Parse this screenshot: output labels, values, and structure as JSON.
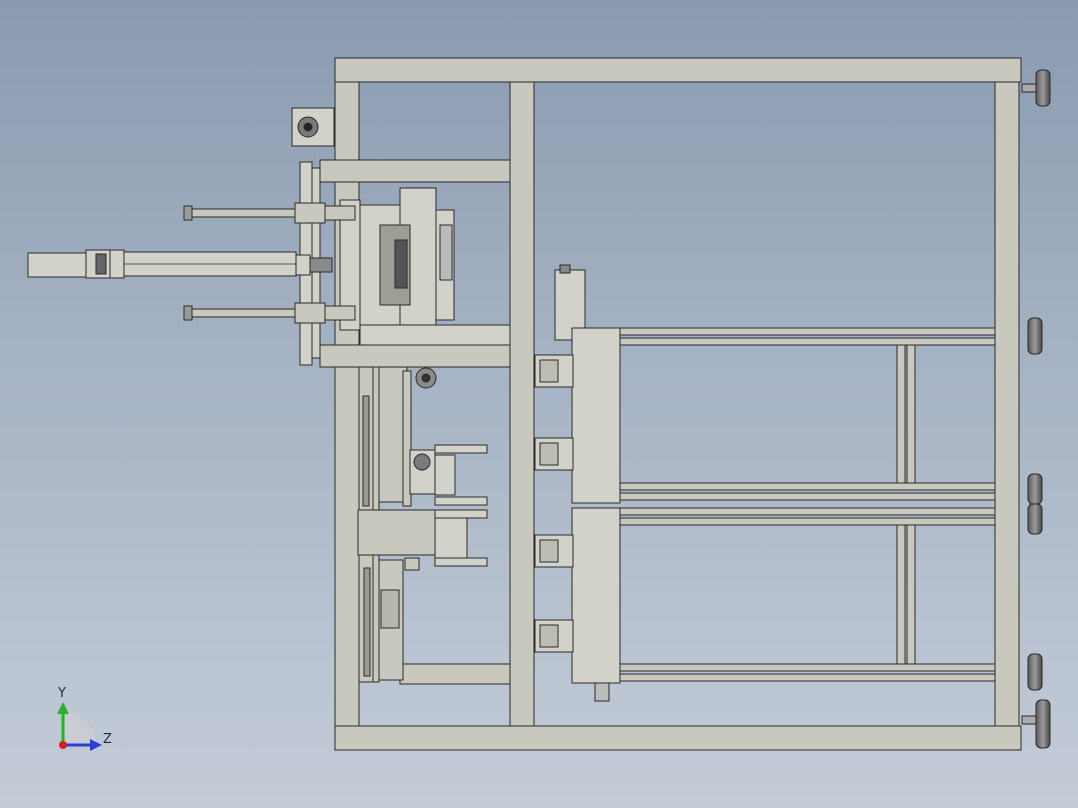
{
  "triad": {
    "y_label": "Y",
    "z_label": "Z",
    "colors": {
      "y": "#2ab02a",
      "z": "#2a3ed8",
      "x": "#d02020"
    }
  },
  "colors": {
    "frame_fill": "#c8c8bf",
    "frame_stroke": "#2a2a2a",
    "part_fill": "#d2d2cb",
    "dark_fill": "#6f6f6f"
  }
}
